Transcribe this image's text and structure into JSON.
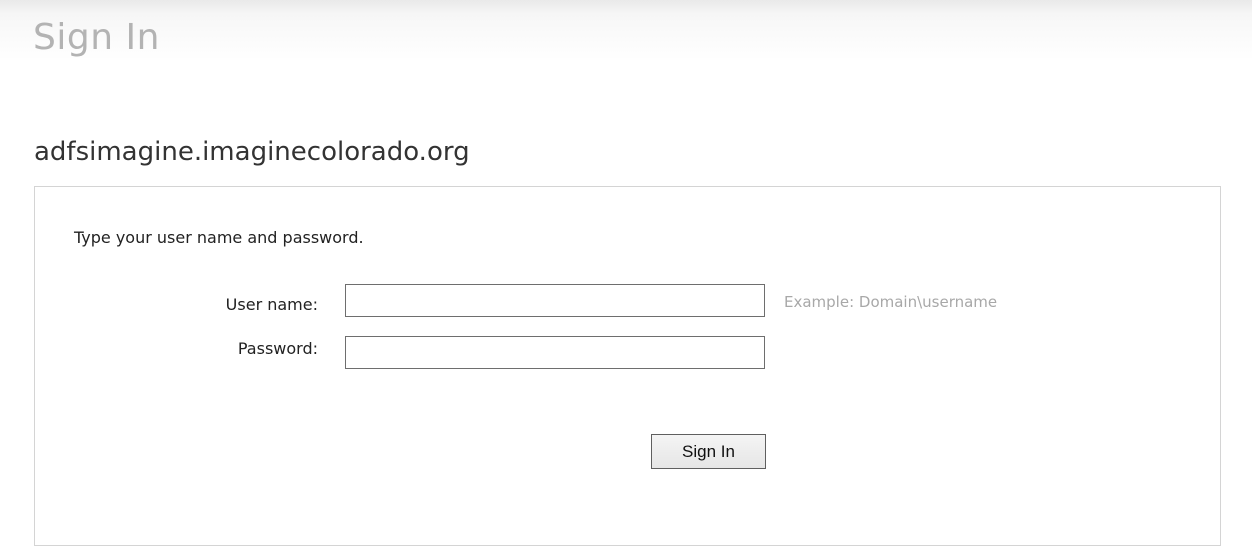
{
  "header": {
    "title": "Sign In"
  },
  "site": {
    "name": "adfsimagine.imaginecolorado.org"
  },
  "form": {
    "instructions": "Type your user name and password.",
    "username": {
      "label": "User name:",
      "value": "",
      "hint": "Example: Domain\\username"
    },
    "password": {
      "label": "Password:",
      "value": ""
    },
    "submit_label": "Sign In"
  },
  "colors": {
    "title_gray": "#b3b3b3",
    "hint_gray": "#a8a8a8",
    "panel_border": "#d4d4d4"
  }
}
